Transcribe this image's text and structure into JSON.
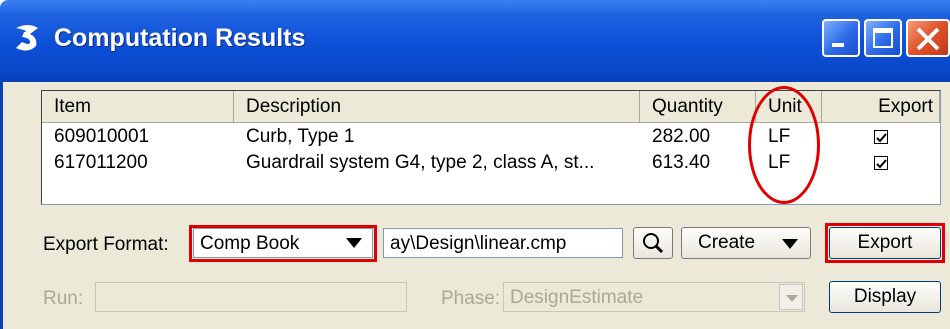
{
  "window": {
    "title": "Computation Results"
  },
  "table": {
    "headers": {
      "item": "Item",
      "description": "Description",
      "quantity": "Quantity",
      "unit": "Unit",
      "export": "Export"
    },
    "rows": [
      {
        "item": "609010001",
        "description": "Curb, Type 1",
        "quantity": "282.00",
        "unit": "LF",
        "export": true
      },
      {
        "item": "617011200",
        "description": "Guardrail system G4, type 2, class A, st...",
        "quantity": "613.40",
        "unit": "LF",
        "export": true
      }
    ]
  },
  "export_format": {
    "label": "Export Format:",
    "selected": "Comp Book"
  },
  "file_path": {
    "value": "ay\\Design\\linear.cmp"
  },
  "create": {
    "label": "Create"
  },
  "buttons": {
    "export": "Export",
    "display": "Display"
  },
  "run": {
    "label": "Run:",
    "value": ""
  },
  "phase": {
    "label": "Phase:",
    "value": "DesignEstimate"
  },
  "colors": {
    "highlight": "#e00000",
    "titlebar": "#0c4fd6",
    "dialog_bg": "#ece9d8"
  }
}
